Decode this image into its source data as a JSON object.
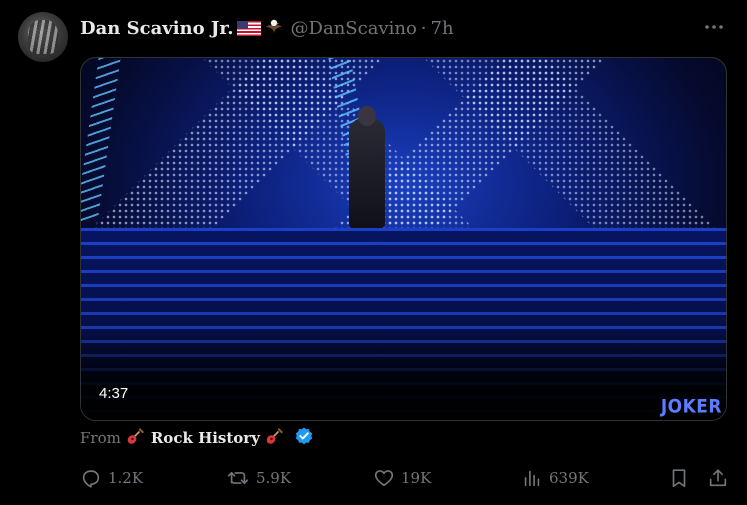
{
  "author": {
    "name": "Dan Scavino Jr.",
    "handle": "@DanScavino",
    "separator": "·",
    "time": "7h",
    "flag_icon": "us-flag-icon",
    "eagle_icon": "eagle-icon"
  },
  "media": {
    "duration": "4:37",
    "watermark": "JOKER"
  },
  "source": {
    "prefix": "From",
    "name": "Rock History",
    "emoji_icon": "guitar-icon",
    "verified_icon": "verified-badge-icon"
  },
  "actions": {
    "replies": "1.2K",
    "retweets": "5.9K",
    "likes": "19K",
    "views": "639K"
  },
  "colors": {
    "background": "#000000",
    "text_primary": "#e7e9ea",
    "text_secondary": "#71767b",
    "verified_blue": "#1d9bf0"
  }
}
